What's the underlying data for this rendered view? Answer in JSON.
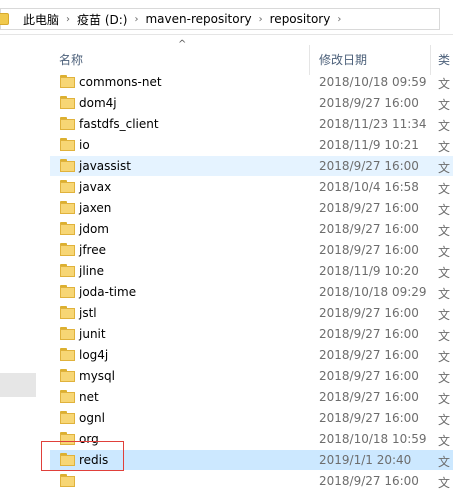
{
  "address_bar": {
    "crumbs": [
      "此电脑",
      "疫苗 (D:)",
      "maven-repository",
      "repository"
    ],
    "separator": "›"
  },
  "columns": {
    "sort_indicator": "^",
    "name": "名称",
    "date": "修改日期",
    "type": "类"
  },
  "files": [
    {
      "name": "commons-net",
      "date": "2018/10/18 09:59",
      "type": "文"
    },
    {
      "name": "dom4j",
      "date": "2018/9/27 16:00",
      "type": "文"
    },
    {
      "name": "fastdfs_client",
      "date": "2018/11/23 11:34",
      "type": "文"
    },
    {
      "name": "io",
      "date": "2018/11/9 10:21",
      "type": "文"
    },
    {
      "name": "javassist",
      "date": "2018/9/27 16:00",
      "type": "文",
      "state": "hover"
    },
    {
      "name": "javax",
      "date": "2018/10/4 16:58",
      "type": "文"
    },
    {
      "name": "jaxen",
      "date": "2018/9/27 16:00",
      "type": "文"
    },
    {
      "name": "jdom",
      "date": "2018/9/27 16:00",
      "type": "文"
    },
    {
      "name": "jfree",
      "date": "2018/9/27 16:00",
      "type": "文"
    },
    {
      "name": "jline",
      "date": "2018/11/9 10:20",
      "type": "文"
    },
    {
      "name": "joda-time",
      "date": "2018/10/18 09:29",
      "type": "文"
    },
    {
      "name": "jstl",
      "date": "2018/9/27 16:00",
      "type": "文"
    },
    {
      "name": "junit",
      "date": "2018/9/27 16:00",
      "type": "文"
    },
    {
      "name": "log4j",
      "date": "2018/9/27 16:00",
      "type": "文"
    },
    {
      "name": "mysql",
      "date": "2018/9/27 16:00",
      "type": "文"
    },
    {
      "name": "net",
      "date": "2018/9/27 16:00",
      "type": "文"
    },
    {
      "name": "ognl",
      "date": "2018/9/27 16:00",
      "type": "文"
    },
    {
      "name": "org",
      "date": "2018/10/18 10:59",
      "type": "文"
    },
    {
      "name": "redis",
      "date": "2019/1/1 20:40",
      "type": "文",
      "state": "selected"
    },
    {
      "name": "",
      "date": "2018/9/27 16:00",
      "type": "文"
    }
  ],
  "colors": {
    "hover_row": "#e5f3ff",
    "selected_row": "#cce8ff",
    "highlight_box": "#e0403a",
    "folder": "#f7d675"
  }
}
